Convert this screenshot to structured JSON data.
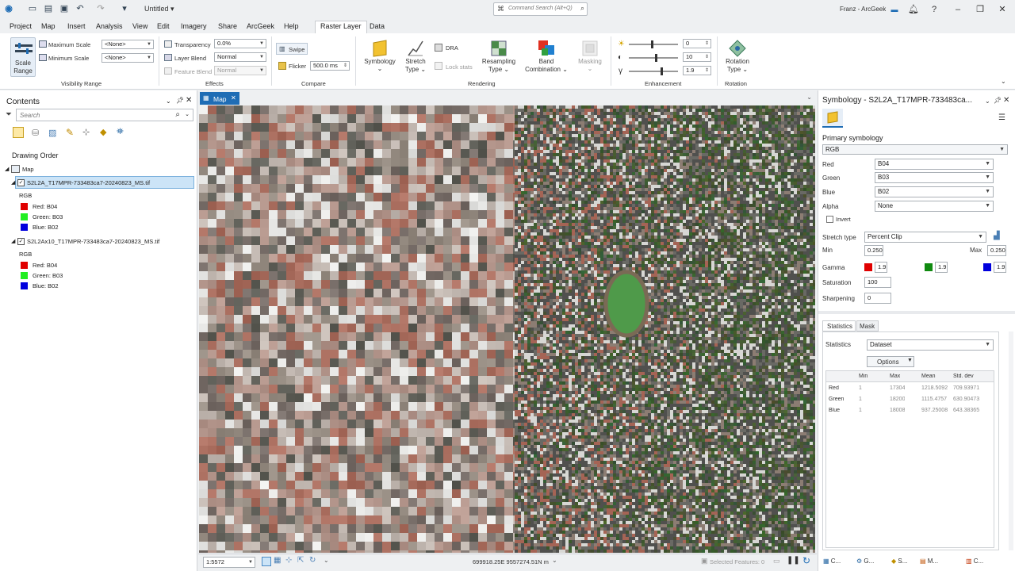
{
  "title_bar": {
    "doc_title": "Untitled",
    "command_search_placeholder": "Command Search (Alt+Q)",
    "user": "Franz - ArcGeek"
  },
  "menu": [
    "Project",
    "Map",
    "Insert",
    "Analysis",
    "View",
    "Edit",
    "Imagery",
    "Share",
    "ArcGeek",
    "Help",
    "Raster Layer",
    "Data"
  ],
  "active_menu": "Raster Layer",
  "ribbon": {
    "visibility_range": {
      "scale_range_l1": "Scale",
      "scale_range_l2": "Range",
      "max_scale_label": "Maximum Scale",
      "min_scale_label": "Minimum Scale",
      "max_scale_value": "<None>",
      "min_scale_value": "<None>",
      "group": "Visibility Range"
    },
    "effects": {
      "transparency_label": "Transparency",
      "transparency_value": "0.0%",
      "layer_blend_label": "Layer Blend",
      "layer_blend_value": "Normal",
      "feature_blend_label": "Feature Blend",
      "feature_blend_value": "Normal",
      "group": "Effects"
    },
    "compare": {
      "swipe": "Swipe",
      "flicker": "Flicker",
      "flicker_value": "500.0",
      "flicker_unit": "ms",
      "group": "Compare"
    },
    "rendering": {
      "symbology": "Symbology",
      "stretch_l1": "Stretch",
      "stretch_l2": "Type",
      "dra": "DRA",
      "lock_stats": "Lock stats",
      "resampling_l1": "Resampling",
      "resampling_l2": "Type",
      "band_l1": "Band",
      "band_l2": "Combination",
      "masking": "Masking",
      "group": "Rendering"
    },
    "enhancement": {
      "brightness": "0",
      "contrast": "10",
      "gamma": "1.9",
      "group": "Enhancement"
    },
    "rotation": {
      "l1": "Rotation",
      "l2": "Type",
      "group": "Rotation"
    }
  },
  "contents": {
    "title": "Contents",
    "search_placeholder": "Search",
    "drawing_order": "Drawing Order",
    "map_name": "Map",
    "layers": [
      {
        "name": "S2L2A_T17MPR-733483ca7-20240823_MS.tif",
        "renderer": "RGB",
        "red": "Red:  B04",
        "green": "Green: B03",
        "blue": "Blue:  B02"
      },
      {
        "name": "S2L2Ax10_T17MPR-733483ca7-20240823_MS.tif",
        "renderer": "RGB",
        "red": "Red:  B04",
        "green": "Green: B03",
        "blue": "Blue:  B02"
      }
    ]
  },
  "map": {
    "tab": "Map",
    "scale": "1:5572",
    "coords": "699918.25E 9557274.51N m",
    "selected_features": "Selected Features: 0"
  },
  "symbology": {
    "title": "Symbology - S2L2A_T17MPR-733483ca...",
    "primary": "Primary symbology",
    "renderer": "RGB",
    "red_label": "Red",
    "red_value": "B04",
    "green_label": "Green",
    "green_value": "B03",
    "blue_label": "Blue",
    "blue_value": "B02",
    "alpha_label": "Alpha",
    "alpha_value": "None",
    "invert": "Invert",
    "stretch_label": "Stretch type",
    "stretch_value": "Percent Clip",
    "min_label": "Min",
    "min_value": "0.250",
    "max_label": "Max",
    "max_value": "0.250",
    "gamma_label": "Gamma",
    "gamma_red": "1.9",
    "gamma_green": "1.9",
    "gamma_blue": "1.9",
    "saturation_label": "Saturation",
    "saturation_value": "100",
    "sharpening_label": "Sharpening",
    "sharpening_value": "0",
    "tabs": [
      "Statistics",
      "Mask"
    ],
    "statistics_label": "Statistics",
    "statistics_value": "Dataset",
    "options": "Options",
    "table": {
      "headers": [
        "",
        "Min",
        "Max",
        "Mean",
        "Std. dev"
      ],
      "rows": [
        [
          "Red",
          "1",
          "17304",
          "1218.5092",
          "709.93971"
        ],
        [
          "Green",
          "1",
          "18200",
          "1115.4757",
          "630.90473"
        ],
        [
          "Blue",
          "1",
          "18008",
          "937.25008",
          "643.38365"
        ]
      ]
    }
  },
  "bottom_tabs": [
    "C...",
    "G...",
    "S...",
    "M...",
    "C..."
  ],
  "colors": {
    "accent": "#1f6db5",
    "red": "#e00000",
    "green": "#22cc22",
    "blue": "#0000dd"
  }
}
